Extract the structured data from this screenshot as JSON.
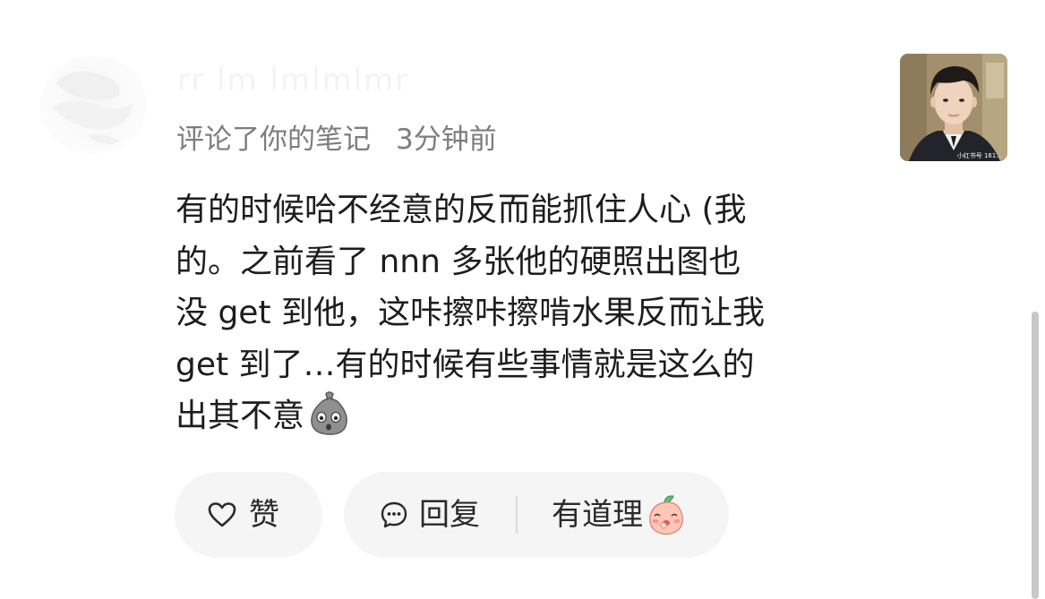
{
  "header": {
    "username": "rr lm lmlmlmr",
    "action_text": "评论了你的笔记",
    "time_text": "3分钟前"
  },
  "note_thumbnail": {
    "caption": "小红书号 161..."
  },
  "comment": {
    "lines": [
      "有的时候哈不经意的反而能抓住人心 (我",
      "的。之前看了 nnn 多张他的硬照出图也",
      "没 get 到他，这咔擦咔擦啃水果反而让我",
      " get 到了…有的时候有些事情就是这么的",
      "出其不意"
    ],
    "emoji": "surprised-bag-emoji"
  },
  "actions": {
    "like_label": "赞",
    "reply_label": "回复",
    "quick_reply_label": "有道理",
    "quick_reply_emoji": "blushing-peach-emoji"
  },
  "colors": {
    "text_primary": "#1d1d1d",
    "text_secondary": "#7d7d7d",
    "pill_background": "#f5f5f5"
  }
}
